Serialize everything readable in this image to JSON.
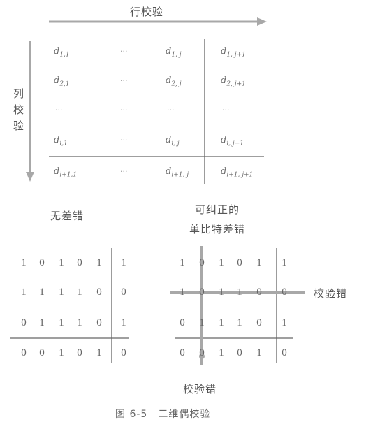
{
  "arrows": {
    "row_check_label": "行校验",
    "col_check_label": [
      "列",
      "校",
      "验"
    ]
  },
  "matrix": {
    "rows": [
      [
        {
          "base": "d",
          "sub": "1,1"
        },
        {
          "dots": "···"
        },
        {
          "base": "d",
          "sub": "1, j"
        },
        {
          "base": "d",
          "sub": "1, j+1"
        }
      ],
      [
        {
          "base": "d",
          "sub": "2,1"
        },
        {
          "dots": "···"
        },
        {
          "base": "d",
          "sub": "2, j"
        },
        {
          "base": "d",
          "sub": "2, j+1"
        }
      ],
      [
        {
          "dots": "···"
        },
        {
          "dots": "···"
        },
        {
          "dots": "···"
        },
        {
          "dots": "···"
        }
      ],
      [
        {
          "base": "d",
          "sub": "i,1"
        },
        {
          "dots": "···"
        },
        {
          "base": "d",
          "sub": "i, j"
        },
        {
          "base": "d",
          "sub": "i, j+1"
        }
      ],
      [
        {
          "base": "d",
          "sub": "i+1,1"
        },
        {
          "dots": "···"
        },
        {
          "base": "d",
          "sub": "i+1, j"
        },
        {
          "base": "d",
          "sub": "i+1, j+1"
        }
      ]
    ]
  },
  "no_error": {
    "title": "无差错",
    "bits": [
      [
        "1",
        "0",
        "1",
        "0",
        "1",
        "1"
      ],
      [
        "1",
        "1",
        "1",
        "1",
        "0",
        "0"
      ],
      [
        "0",
        "1",
        "1",
        "1",
        "0",
        "1"
      ],
      [
        "0",
        "0",
        "1",
        "0",
        "1",
        "0"
      ]
    ]
  },
  "correctable": {
    "title_line1": "可纠正的",
    "title_line2": "单比特差错",
    "bits": [
      [
        "1",
        "0",
        "1",
        "0",
        "1",
        "1"
      ],
      [
        "1",
        "0",
        "1",
        "1",
        "0",
        "0"
      ],
      [
        "0",
        "1",
        "1",
        "1",
        "0",
        "1"
      ],
      [
        "0",
        "0",
        "1",
        "0",
        "1",
        "0"
      ]
    ],
    "row_error_label": "校验错",
    "col_error_label": "校验错"
  },
  "caption": "图 6-5　二维偶校验",
  "colors": {
    "arrow": "#9a9a9a",
    "line": "#666666",
    "highlight": "#a8a8a8"
  }
}
